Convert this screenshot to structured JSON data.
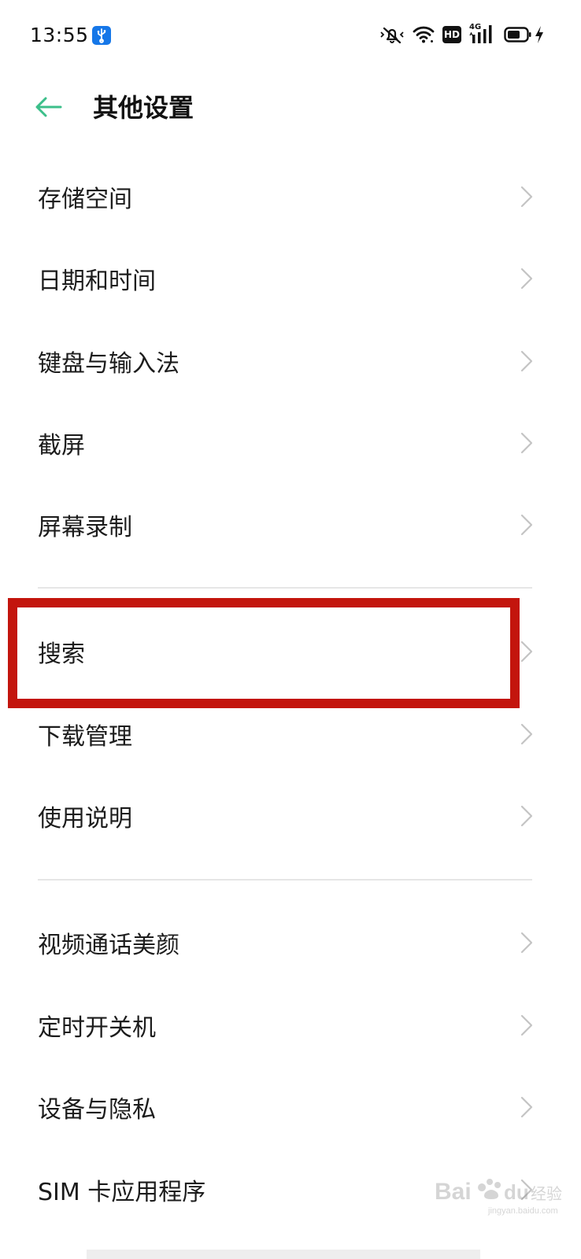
{
  "status_bar": {
    "time": "13:55",
    "usb_icon": "usb-icon",
    "icons": [
      "mute-icon",
      "wifi-icon",
      "hd-icon",
      "cellular-signal-icon",
      "battery-icon",
      "charging-icon"
    ],
    "hd_label": "HD",
    "network_label": "4G",
    "colors": {
      "usb_badge": "#1677e8"
    }
  },
  "header": {
    "back_icon": "arrow-left-icon",
    "title": "其他设置",
    "colors": {
      "back_arrow": "#3cbf8a"
    }
  },
  "groups": [
    {
      "items": [
        {
          "label": "存储空间"
        },
        {
          "label": "日期和时间"
        },
        {
          "label": "键盘与输入法"
        },
        {
          "label": "截屏"
        },
        {
          "label": "屏幕录制"
        }
      ]
    },
    {
      "items": [
        {
          "label": "搜索",
          "highlighted": true
        },
        {
          "label": "下载管理"
        },
        {
          "label": "使用说明"
        }
      ]
    },
    {
      "items": [
        {
          "label": "视频通话美颜"
        },
        {
          "label": "定时开关机"
        },
        {
          "label": "设备与隐私"
        },
        {
          "label": "SIM 卡应用程序"
        }
      ]
    }
  ],
  "annotation": {
    "highlight_color": "#c3150d"
  },
  "watermark": {
    "text": "Bai du 经验",
    "sub": "jingyan.baidu.com"
  }
}
